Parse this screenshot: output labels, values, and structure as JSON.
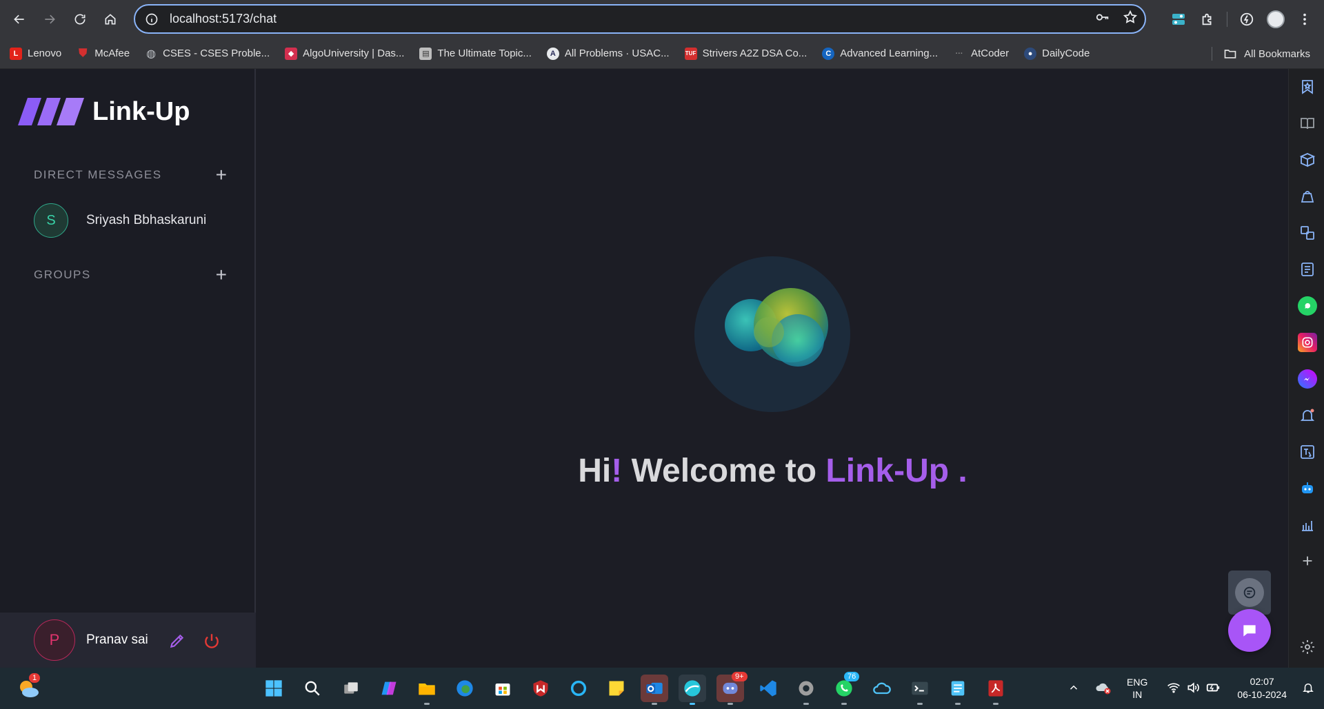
{
  "browser": {
    "url": "localhost:5173/chat",
    "bookmarks": [
      {
        "label": "Lenovo",
        "icon": "lenovo-icon",
        "color": "#e2231a",
        "glyph": "L"
      },
      {
        "label": "McAfee",
        "icon": "mcafee-icon",
        "color": "#c01818",
        "glyph": "M"
      },
      {
        "label": "CSES - CSES Proble...",
        "icon": "globe-icon",
        "color": "#5f6368",
        "glyph": "◎"
      },
      {
        "label": "AlgoUniversity | Das...",
        "icon": "algouniversity-icon",
        "color": "#d32f4f",
        "glyph": "◆"
      },
      {
        "label": "The Ultimate Topic...",
        "icon": "document-icon",
        "color": "#9e9e9e",
        "glyph": "▤"
      },
      {
        "label": "All Problems · USAC...",
        "icon": "usaco-icon",
        "color": "#3b3f7a",
        "glyph": "A"
      },
      {
        "label": "Strivers A2Z DSA Co...",
        "icon": "tuf-icon",
        "color": "#d32f2f",
        "glyph": "T"
      },
      {
        "label": "Advanced Learning...",
        "icon": "codeforces-icon",
        "color": "#1565c0",
        "glyph": "C"
      },
      {
        "label": "AtCoder",
        "icon": "atcoder-icon",
        "color": "#444",
        "glyph": "·"
      },
      {
        "label": "DailyCode",
        "icon": "dailycode-icon",
        "color": "#2d4a7a",
        "glyph": "●"
      }
    ],
    "all_bookmarks": "All Bookmarks"
  },
  "app": {
    "brand": "Link-Up",
    "direct_messages_title": "DIRECT MESSAGES",
    "groups_title": "GROUPS",
    "contacts": [
      {
        "initial": "S",
        "name": "Sriyash Bbhaskaruni"
      }
    ],
    "user": {
      "initial": "P",
      "name": "Pranav sai"
    },
    "welcome": {
      "hi": "Hi",
      "excl": "!",
      "middle": " Welcome to ",
      "brand": "Link-Up",
      "dot": " ."
    },
    "accent_color": "#a55eea"
  },
  "taskbar": {
    "weather_badge": "1",
    "discord_badge": "9+",
    "whatsapp_badge": "76",
    "lang_line1": "ENG",
    "lang_line2": "IN",
    "time": "02:07",
    "date": "06-10-2024"
  }
}
